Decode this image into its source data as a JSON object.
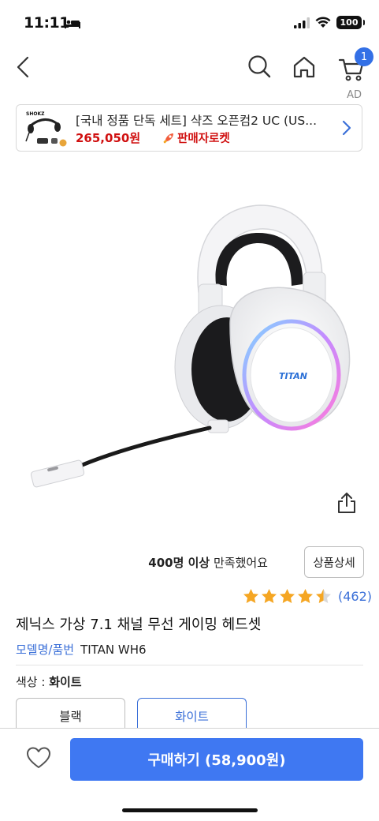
{
  "status": {
    "time": "11:11",
    "battery": "100"
  },
  "nav": {
    "cart_count": "1",
    "icons": [
      "back-arrow-icon",
      "search-icon",
      "home-icon",
      "cart-icon"
    ]
  },
  "ad": {
    "label": "AD",
    "title": "[국내 정품 단독 세트] 샥즈 오픈컴2 UC (US...",
    "price": "265,050원",
    "delivery": "판매자로켓"
  },
  "product": {
    "satisfaction_count": "400명 이상",
    "satisfaction_text": " 만족했어요",
    "detail_button": "상품상세",
    "rating_stars": 4.5,
    "review_count": "(462)",
    "title": "제닉스 가상 7.1 채널 무선 게이밍 헤드셋",
    "model_label": "모델명/품번",
    "model_value": "TITAN WH6",
    "color_label": "색상 : ",
    "color_value": "화이트",
    "headset_brand": "TITAN",
    "options": [
      "블랙",
      "화이트"
    ],
    "selected_option": "화이트"
  },
  "bottom": {
    "buy_label": "구매하기 (58,900원)"
  },
  "colors": {
    "accent": "#3f78f2",
    "link": "#3a6fd8",
    "price_red": "#d00f0f",
    "star": "#f5a623"
  }
}
